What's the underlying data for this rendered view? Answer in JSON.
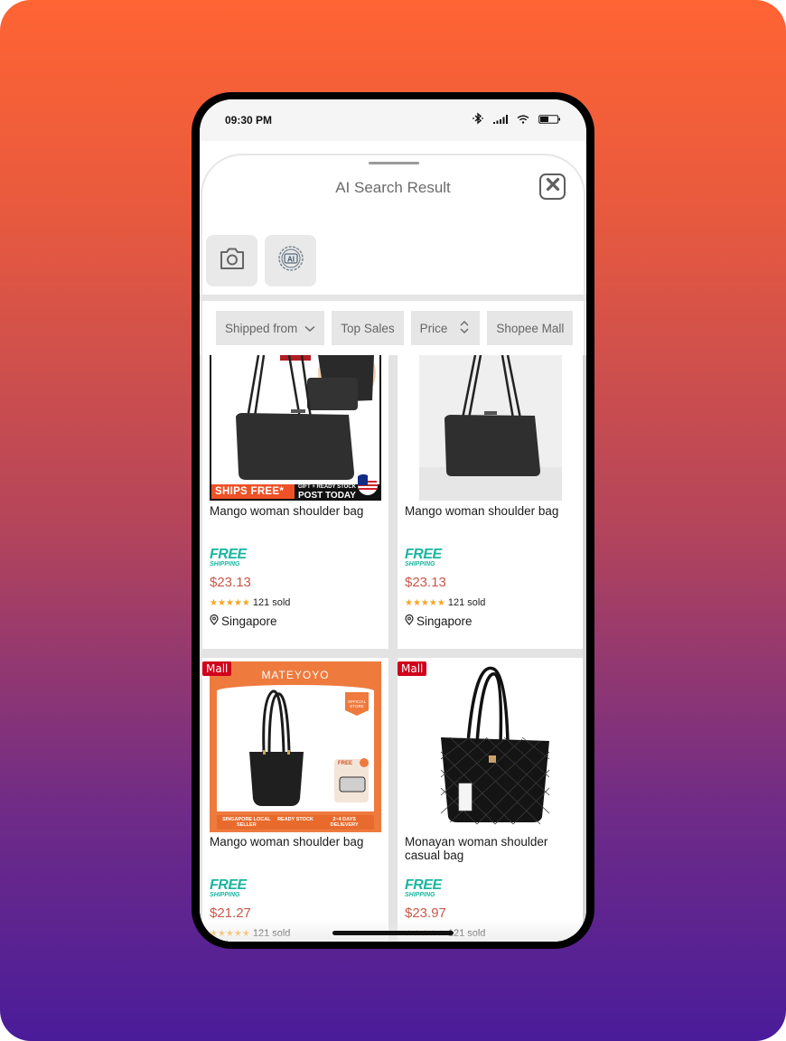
{
  "status_bar": {
    "time": "09:30 PM",
    "icons": [
      "bluetooth-icon",
      "signal-icon",
      "wifi-icon",
      "battery-icon"
    ]
  },
  "sheet": {
    "title": "AI Search Result",
    "close_icon": "close-icon",
    "tools": [
      {
        "name": "camera-search",
        "icon": "camera-icon"
      },
      {
        "name": "ai-search",
        "icon": "ai-chip-icon",
        "label": "AI"
      }
    ]
  },
  "filters": [
    {
      "label": "Shipped from",
      "icon": "chevron-down-icon"
    },
    {
      "label": "Top Sales"
    },
    {
      "label": "Price",
      "icon": "sort-icon"
    },
    {
      "label": "Shopee Mall"
    }
  ],
  "products": [
    {
      "name": "Mango woman shoulder bag",
      "shipping_badge": {
        "top": "FREE",
        "bottom": "SHIPPING"
      },
      "price": "$23.13",
      "rating": 5,
      "sold": "121 sold",
      "location": "Singapore",
      "mall": false,
      "banner": {
        "left": "SHIPS FREE*",
        "right_top": "GIFT + READY STOCK",
        "right_bottom": "POST TODAY"
      }
    },
    {
      "name": "Mango woman shoulder bag",
      "shipping_badge": {
        "top": "FREE",
        "bottom": "SHIPPING"
      },
      "price": "$23.13",
      "rating": 5,
      "sold": "121 sold",
      "location": "Singapore",
      "mall": false
    },
    {
      "name": "Mango woman shoulder bag",
      "shipping_badge": {
        "top": "FREE",
        "bottom": "SHIPPING"
      },
      "price": "$21.27",
      "rating": 5,
      "sold": "121 sold",
      "mall": true,
      "mall_label": "Mall",
      "image_text": {
        "brand": "MATEYOYO",
        "official": "OFFICIAL STORE",
        "free": "FREE",
        "footer": [
          "SINGAPORE LOCAL SELLER",
          "READY STOCK",
          "2~4 DAYS DELIEVERY"
        ]
      }
    },
    {
      "name": "Monayan woman shoulder casual bag",
      "shipping_badge": {
        "top": "FREE",
        "bottom": "SHIPPING"
      },
      "price": "$23.97",
      "rating": 5,
      "sold": "121 sold",
      "mall": true,
      "mall_label": "Mall"
    }
  ],
  "stars_glyph": "★★★★★",
  "colors": {
    "price": "#c9574a",
    "free_shipping": "#1bb5a0",
    "mall_badge": "#d0011b",
    "stars": "#f6a623",
    "bg_top": "#ff6433",
    "bg_bottom": "#4a1c9a"
  }
}
